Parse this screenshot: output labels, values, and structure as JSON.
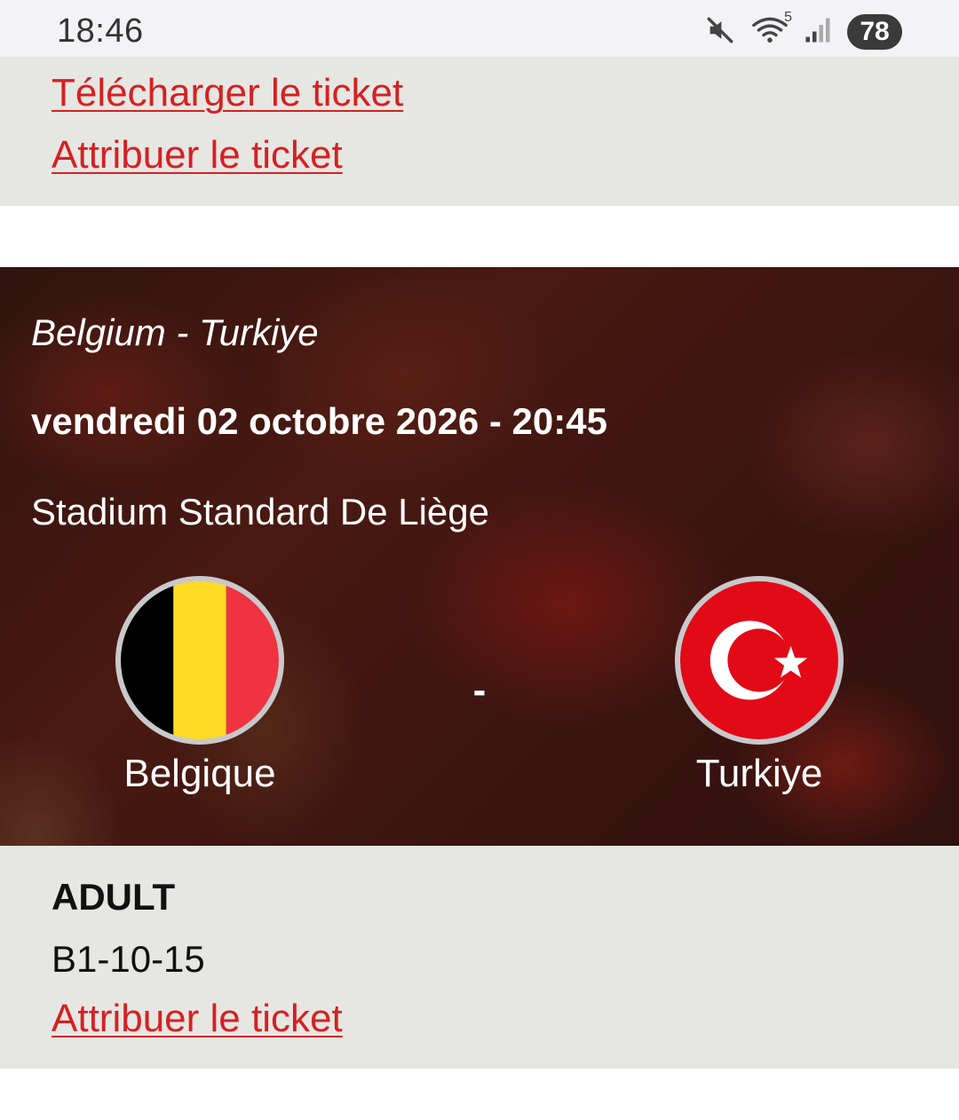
{
  "status_bar": {
    "time": "18:46",
    "battery": "78",
    "wifi_badge": "5",
    "icons": [
      "mute-icon",
      "wifi-icon",
      "signal-icon"
    ]
  },
  "actions": {
    "download_ticket": "Télécharger le ticket",
    "assign_ticket": "Attribuer le ticket"
  },
  "match": {
    "name": "Belgium - Turkiye",
    "datetime": "vendredi 02 octobre 2026 - 20:45",
    "venue": "Stadium Standard De Liège",
    "separator": "-",
    "home_team": "Belgique",
    "away_team": "Turkiye"
  },
  "ticket": {
    "category": "ADULT",
    "seat": "B1-10-15",
    "assign_label": "Attribuer le ticket"
  },
  "colors": {
    "link_red": "#d42121",
    "panel_grey": "#e6e6e3",
    "belgium_flag": [
      "#000000",
      "#fdda24",
      "#ef3340"
    ],
    "turkey_flag": "#e30a17"
  }
}
